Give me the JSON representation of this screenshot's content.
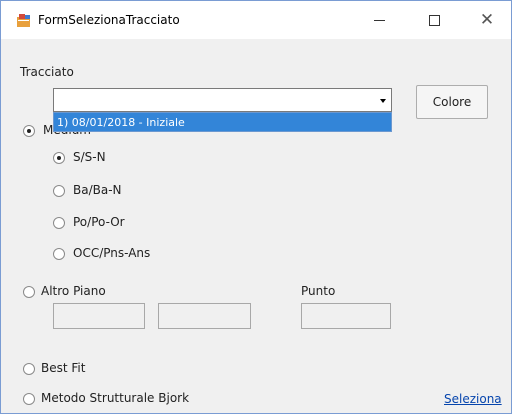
{
  "window": {
    "title": "FormSelezionaTracciato",
    "minimize_icon": "minimize-icon",
    "maximize_icon": "maximize-icon",
    "close_icon": "close-icon",
    "close_glyph": "✕"
  },
  "tracciato": {
    "label": "Tracciato",
    "combo_value": "",
    "dropdown_items": [
      "1) 08/01/2018 - Iniziale"
    ],
    "colore_button": "Colore"
  },
  "medium_group": {
    "label": "Medium",
    "checked": true,
    "options": [
      {
        "label": "S/S-N",
        "checked": true
      },
      {
        "label": "Ba/Ba-N",
        "checked": false
      },
      {
        "label": "Po/Po-Or",
        "checked": false
      },
      {
        "label": "OCC/Pns-Ans",
        "checked": false
      }
    ]
  },
  "altro_piano": {
    "label": "Altro Piano",
    "checked": false,
    "field1_value": "",
    "field2_value": ""
  },
  "punto": {
    "label": "Punto",
    "value": ""
  },
  "best_fit": {
    "label": "Best Fit",
    "checked": false
  },
  "metodo": {
    "label": "Metodo Strutturale Bjork",
    "checked": false
  },
  "seleziona_link": "Seleziona",
  "colors": {
    "selection": "#3385d8",
    "link": "#0645ad"
  }
}
